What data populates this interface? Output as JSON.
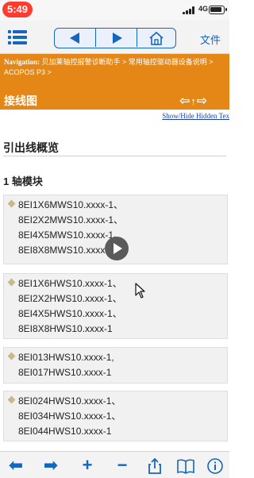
{
  "status": {
    "time": "5:49",
    "network": "4G"
  },
  "toolbar": {
    "files_label": "文件"
  },
  "header": {
    "breadcrumb_prefix": "Navigation:",
    "breadcrumb_path": " 贝加莱轴控报警诊断助手 > 常用轴控驱动器设备说明 > ACOPOS P3 >",
    "title": "接线图"
  },
  "content": {
    "show_hide": "Show/Hide Hidden Tex",
    "overview_heading": "引出线概览",
    "axis_heading": "1 轴模块",
    "groups": [
      {
        "items": [
          "8EI1X6MWS10.xxxx-1、",
          "8EI2X2MWS10.xxxx-1、",
          "8EI4X5MWS10.xxxx-1、",
          "8EI8X8MWS10.xxxx-1"
        ]
      },
      {
        "items": [
          "8EI1X6HWS10.xxxx-1、",
          "8EI2X2HWS10.xxxx-1、",
          "8EI4X5HWS10.xxxx-1、",
          "8EI8X8HWS10.xxxx-1"
        ]
      },
      {
        "items": [
          "8EI013HWS10.xxxx-1,",
          "8EI017HWS10.xxxx-1"
        ]
      },
      {
        "items": [
          "8EI024HWS10.xxxx-1、",
          "8EI034HWS10.xxxx-1、",
          "8EI044HWS10.xxxx-1"
        ]
      }
    ]
  },
  "icons": {
    "toolbar": [
      "menu-icon",
      "back-arrow-icon",
      "forward-arrow-icon",
      "home-icon"
    ],
    "bottom": [
      "back-icon",
      "forward-icon",
      "add-icon",
      "minus-icon",
      "share-icon",
      "book-icon",
      "info-icon"
    ]
  },
  "colors": {
    "accent": "#1566c0",
    "header": "#e48717",
    "time_pill": "#ff3b30"
  }
}
